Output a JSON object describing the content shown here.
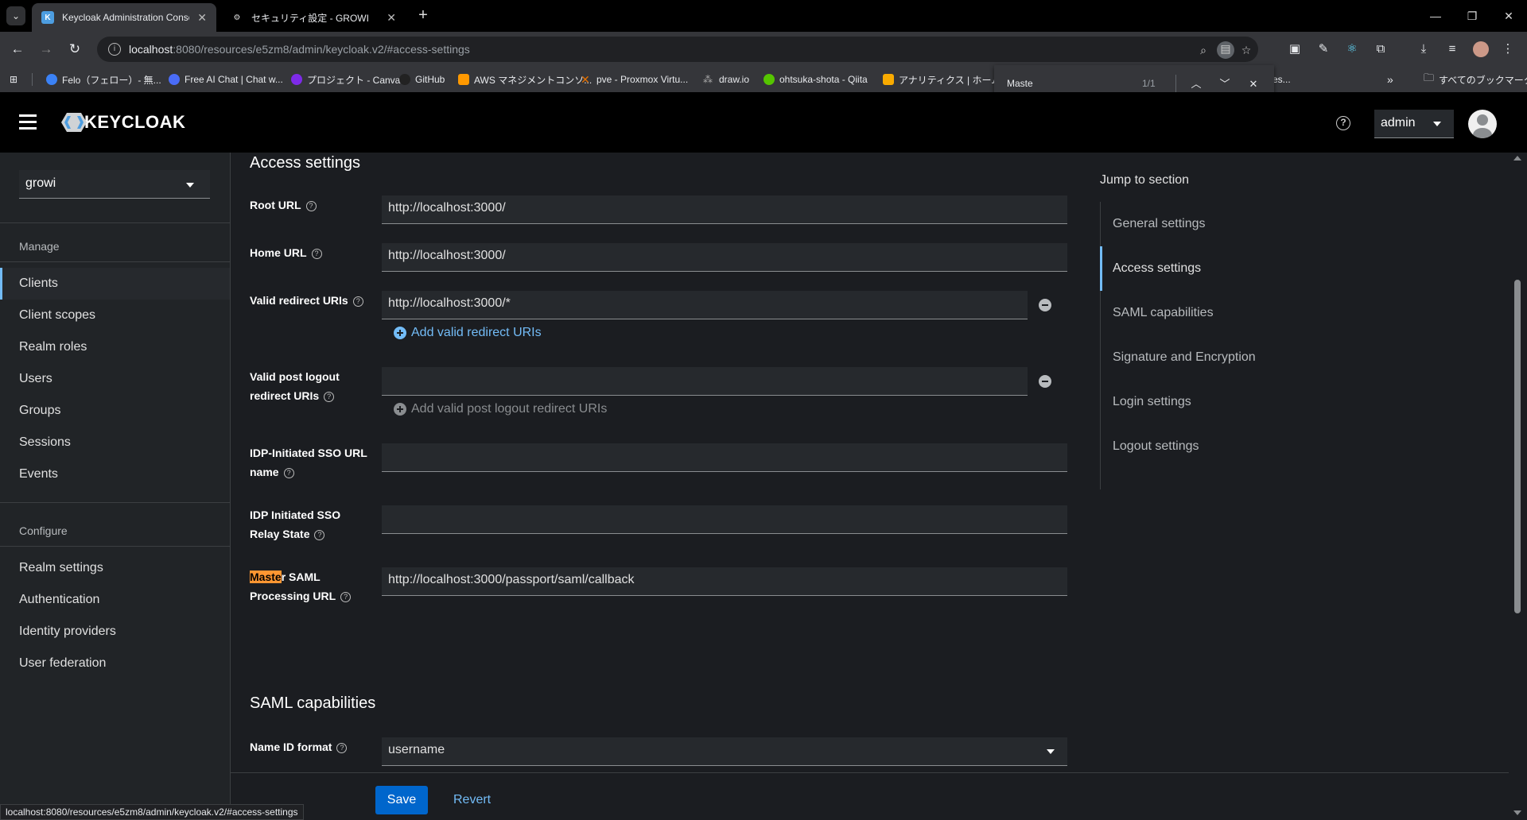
{
  "browser": {
    "tabs": [
      {
        "title": "Keycloak Administration Conso",
        "active": true
      },
      {
        "title": "セキュリティ設定 - GROWI",
        "active": false
      }
    ],
    "url_host": "localhost",
    "url_path": ":8080/resources/e5zm8/admin/keycloak.v2/#access-settings",
    "bookmarks": [
      {
        "label": "Felo（フェロー）- 無...",
        "color": "#3b82f6"
      },
      {
        "label": "Free AI Chat | Chat w...",
        "color": "#4a6cf7"
      },
      {
        "label": "プロジェクト - Canva",
        "color": "#7d2ae8"
      },
      {
        "label": "GitHub",
        "color": "#222222"
      },
      {
        "label": "AWS マネジメントコンソ...",
        "color": "#ff9900"
      },
      {
        "label": "pve - Proxmox Virtu...",
        "color": "#e57000"
      },
      {
        "label": "draw.io",
        "color": "#aaaaaa"
      },
      {
        "label": "ohtsuka-shota - Qiita",
        "color": "#55c500"
      },
      {
        "label": "アナリティクス | ホーム",
        "color": "#f9ab00"
      }
    ],
    "bookmarks_overflow_tail": "es...",
    "all_bookmarks": "すべてのブックマーク",
    "find": {
      "query": "Maste",
      "count": "1/1"
    },
    "status_url": "localhost:8080/resources/e5zm8/admin/keycloak.v2/#access-settings"
  },
  "header": {
    "logo": "KEYCLOAK",
    "user": "admin"
  },
  "sidebar": {
    "realm": "growi",
    "manage_label": "Manage",
    "manage_items": [
      "Clients",
      "Client scopes",
      "Realm roles",
      "Users",
      "Groups",
      "Sessions",
      "Events"
    ],
    "active_item": "Clients",
    "configure_label": "Configure",
    "configure_items": [
      "Realm settings",
      "Authentication",
      "Identity providers",
      "User federation"
    ]
  },
  "access": {
    "title": "Access settings",
    "root_url_label": "Root URL",
    "root_url": "http://localhost:3000/",
    "home_url_label": "Home URL",
    "home_url": "http://localhost:3000/",
    "redirect_label": "Valid redirect URIs",
    "redirect_value": "http://localhost:3000/*",
    "add_redirect": "Add valid redirect URIs",
    "post_logout_label_1": "Valid post logout",
    "post_logout_label_2": "redirect URIs",
    "post_logout_value": "",
    "add_post_logout": "Add valid post logout redirect URIs",
    "idp_sso_label_1": "IDP-Initiated SSO URL",
    "idp_sso_label_2": "name",
    "idp_sso_value": "",
    "relay_label_1": "IDP Initiated SSO",
    "relay_label_2": "Relay State",
    "relay_value": "",
    "master_label_hl": "Maste",
    "master_label_rest": "r SAML",
    "master_label_2": "Processing URL",
    "master_value": "http://localhost:3000/passport/saml/callback"
  },
  "saml": {
    "title": "SAML capabilities",
    "name_id_label": "Name ID format",
    "name_id_value": "username"
  },
  "jump": {
    "title": "Jump to section",
    "items": [
      "General settings",
      "Access settings",
      "SAML capabilities",
      "Signature and Encryption",
      "Login settings",
      "Logout settings"
    ],
    "active": "Access settings"
  },
  "footer": {
    "save": "Save",
    "revert": "Revert"
  },
  "colors": {
    "accent": "#73bcf7",
    "primary_button": "#0066cc",
    "find_highlight": "#ff9632"
  }
}
